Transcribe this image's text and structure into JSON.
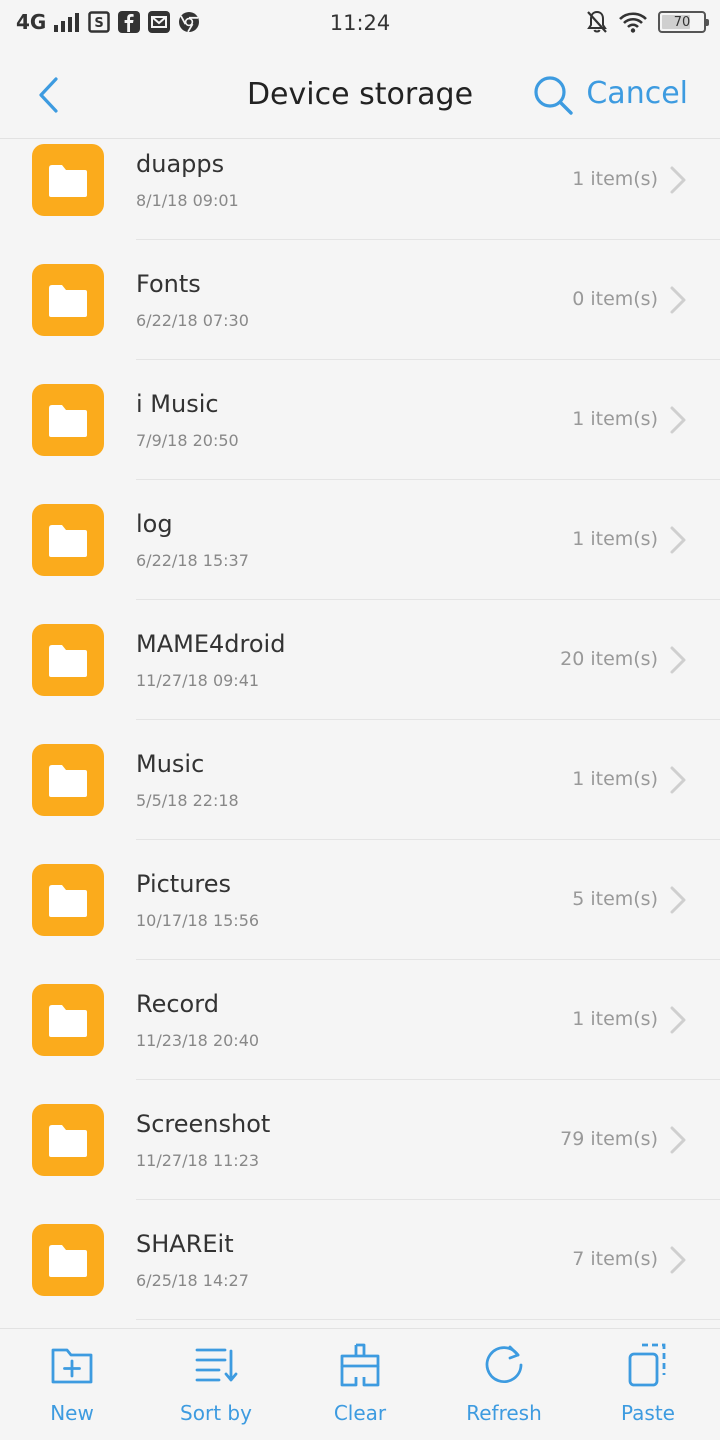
{
  "status_bar": {
    "network": "4G",
    "time": "11:24",
    "battery_level": "70",
    "battery_fraction": 0.7
  },
  "header": {
    "title": "Device storage",
    "cancel_label": "Cancel",
    "back_icon": "chevron-left-icon",
    "search_icon": "search-icon"
  },
  "files": [
    {
      "name": "duapps",
      "date": "8/1/18 09:01",
      "count": "1 item(s)"
    },
    {
      "name": "Fonts",
      "date": "6/22/18 07:30",
      "count": "0 item(s)"
    },
    {
      "name": "i Music",
      "date": "7/9/18 20:50",
      "count": "1 item(s)"
    },
    {
      "name": "log",
      "date": "6/22/18 15:37",
      "count": "1 item(s)"
    },
    {
      "name": "MAME4droid",
      "date": "11/27/18 09:41",
      "count": "20 item(s)"
    },
    {
      "name": "Music",
      "date": "5/5/18 22:18",
      "count": "1 item(s)"
    },
    {
      "name": "Pictures",
      "date": "10/17/18 15:56",
      "count": "5 item(s)"
    },
    {
      "name": "Record",
      "date": "11/23/18 20:40",
      "count": "1 item(s)"
    },
    {
      "name": "Screenshot",
      "date": "11/27/18 11:23",
      "count": "79 item(s)"
    },
    {
      "name": "SHAREit",
      "date": "6/25/18 14:27",
      "count": "7 item(s)"
    }
  ],
  "toolbar": {
    "new_label": "New",
    "sort_label": "Sort by",
    "clear_label": "Clear",
    "refresh_label": "Refresh",
    "paste_label": "Paste"
  },
  "colors": {
    "accent": "#3d9be0",
    "folder": "#fbab1c"
  }
}
